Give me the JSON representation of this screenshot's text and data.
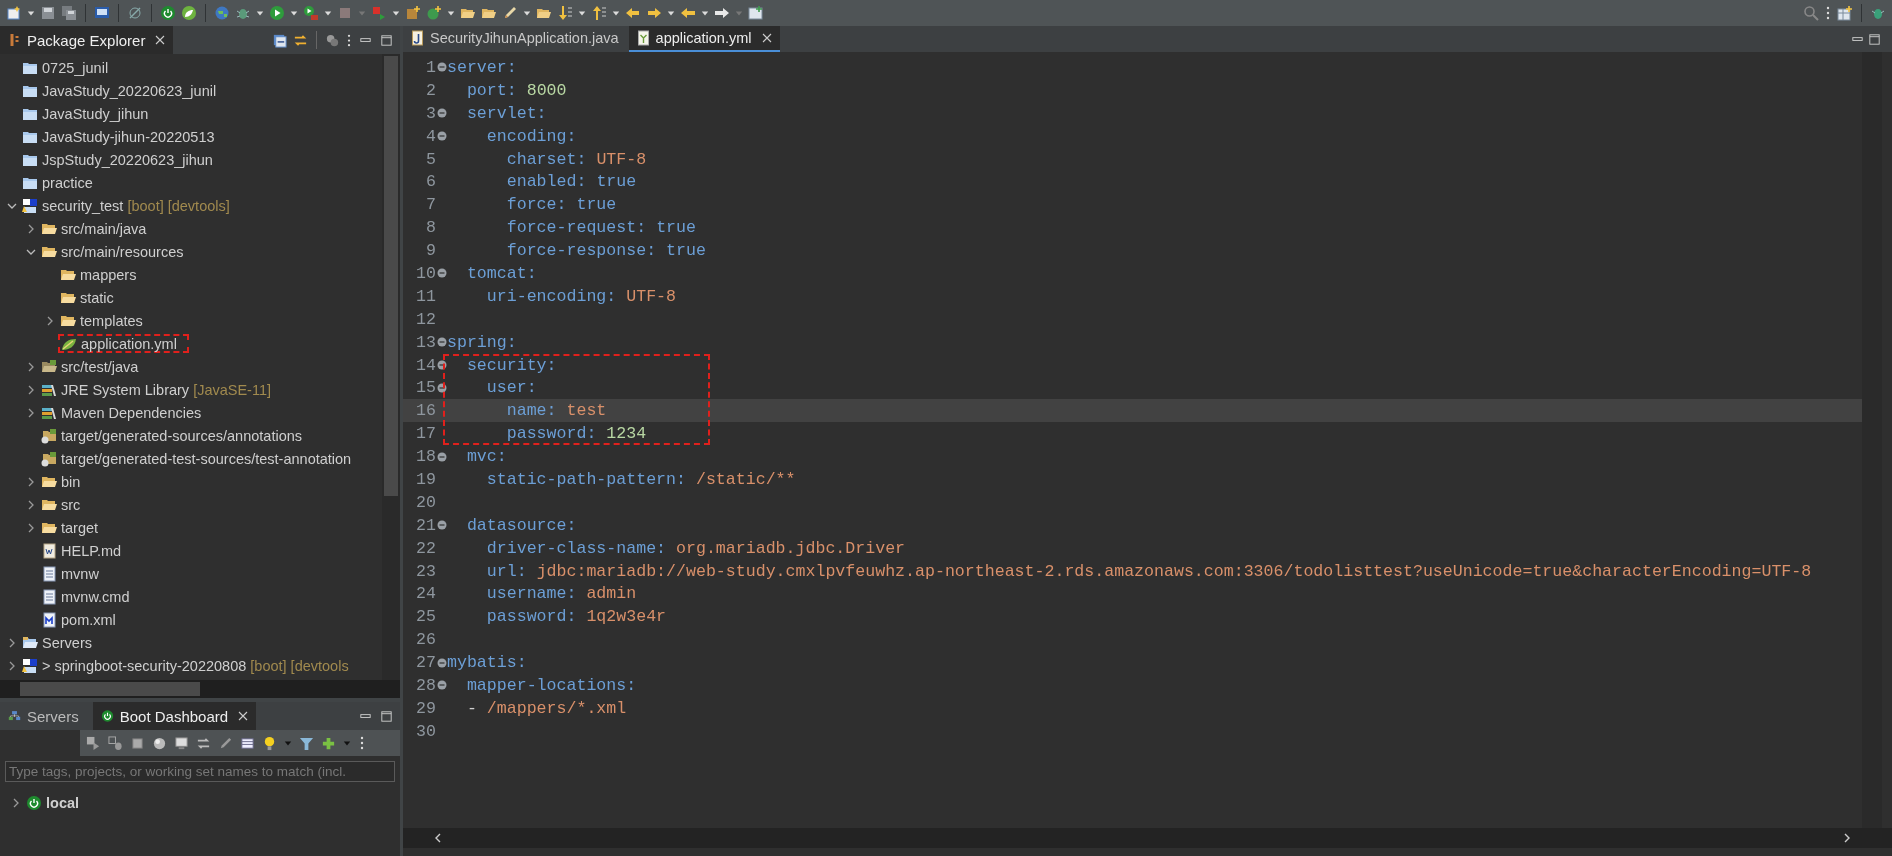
{
  "package_explorer": {
    "tabs": [
      {
        "label": "Package Explorer",
        "selected": true
      }
    ],
    "tree": [
      {
        "label": "0725_junil",
        "kind": "project"
      },
      {
        "label": "JavaStudy_20220623_junil",
        "kind": "project"
      },
      {
        "label": "JavaStudy_jihun",
        "kind": "project"
      },
      {
        "label": "JavaStudy-jihun-20220513",
        "kind": "project"
      },
      {
        "label": "JspStudy_20220623_jihun",
        "kind": "project"
      },
      {
        "label": "practice",
        "kind": "project"
      },
      {
        "label": "security_test",
        "decoration": "[boot] [devtools]",
        "kind": "boot",
        "expanded": true,
        "children": [
          {
            "label": "src/main/java",
            "kind": "folder",
            "expanded": false
          },
          {
            "label": "src/main/resources",
            "kind": "folder",
            "expanded": true,
            "children": [
              {
                "label": "mappers",
                "kind": "folder"
              },
              {
                "label": "static",
                "kind": "folder"
              },
              {
                "label": "templates",
                "kind": "folder",
                "expanded": false
              },
              {
                "label": "application.yml",
                "kind": "yaml",
                "highlighted": true
              }
            ]
          },
          {
            "label": "src/test/java",
            "kind": "test",
            "expanded": false
          },
          {
            "label": "JRE System Library",
            "decoration": "[JavaSE-11]",
            "kind": "library",
            "expanded": false
          },
          {
            "label": "Maven Dependencies",
            "kind": "library",
            "expanded": false
          },
          {
            "label": "target/generated-sources/annotations",
            "kind": "generated"
          },
          {
            "label": "target/generated-test-sources/test-annotation",
            "kind": "generated"
          },
          {
            "label": "bin",
            "kind": "folder",
            "expanded": false
          },
          {
            "label": "src",
            "kind": "folder",
            "expanded": false
          },
          {
            "label": "target",
            "kind": "folder",
            "expanded": false
          },
          {
            "label": "HELP.md",
            "kind": "markdown"
          },
          {
            "label": "mvnw",
            "kind": "text"
          },
          {
            "label": "mvnw.cmd",
            "kind": "text"
          },
          {
            "label": "pom.xml",
            "kind": "maven"
          }
        ]
      },
      {
        "label": "Servers",
        "kind": "servers",
        "expanded": false
      },
      {
        "label": "springboot-security-20220808",
        "prefix": ">",
        "decoration": "[boot] [devtools",
        "kind": "boot",
        "expanded": false
      }
    ]
  },
  "boot_dashboard": {
    "tabs": [
      {
        "label": "Servers",
        "kind": "servers",
        "selected": false
      },
      {
        "label": "Boot Dashboard",
        "kind": "power",
        "selected": true
      }
    ],
    "filter": {
      "placeholder": "Type tags, projects, or working set names to match (incl."
    },
    "tree": [
      {
        "label": "local",
        "expanded": false
      }
    ]
  },
  "editor": {
    "tabs": [
      {
        "label": "SecurityJihunApplication.java",
        "kind": "java",
        "selected": false
      },
      {
        "label": "application.yml",
        "kind": "yaml",
        "selected": true
      }
    ],
    "code_lines": [
      {
        "number": "1",
        "key": "server:",
        "foldable": true
      },
      {
        "number": "2",
        "key": "  port:",
        "value": "8000",
        "kind": "number"
      },
      {
        "number": "3",
        "key": "  servlet:",
        "foldable": true
      },
      {
        "number": "4",
        "key": "    encoding:",
        "foldable": true
      },
      {
        "number": "5",
        "key": "      charset:",
        "value": "UTF-8",
        "kind": "string"
      },
      {
        "number": "6",
        "key": "      enabled:",
        "value": "true",
        "kind": "boolean"
      },
      {
        "number": "7",
        "key": "      force:",
        "value": "true",
        "kind": "boolean"
      },
      {
        "number": "8",
        "key": "      force-request:",
        "value": "true",
        "kind": "boolean"
      },
      {
        "number": "9",
        "key": "      force-response:",
        "value": "true",
        "kind": "boolean"
      },
      {
        "number": "10",
        "key": "  tomcat:",
        "foldable": true
      },
      {
        "number": "11",
        "key": "    uri-encoding:",
        "value": "UTF-8",
        "kind": "string"
      },
      {
        "number": "12"
      },
      {
        "number": "13",
        "key": "spring:",
        "foldable": true
      },
      {
        "number": "14",
        "key": "  security:",
        "foldable": true,
        "highlighted": true
      },
      {
        "number": "15",
        "key": "    user:",
        "foldable": true,
        "highlighted": true
      },
      {
        "number": "16",
        "key": "      name:",
        "value": "test",
        "kind": "string",
        "highlighted": true,
        "current": true
      },
      {
        "number": "17",
        "key": "      password:",
        "value": "1234",
        "kind": "number",
        "highlighted": true
      },
      {
        "number": "18",
        "key": "  mvc:",
        "foldable": true
      },
      {
        "number": "19",
        "key": "    static-path-pattern:",
        "value": "/static/**",
        "kind": "string"
      },
      {
        "number": "20"
      },
      {
        "number": "21",
        "key": "  datasource:",
        "foldable": true
      },
      {
        "number": "22",
        "key": "    driver-class-name:",
        "value": "org.mariadb.jdbc.Driver",
        "kind": "string"
      },
      {
        "number": "23",
        "key": "    url:",
        "value": "jdbc:mariadb://web-study.cmxlpvfeuwhz.ap-northeast-2.rds.amazonaws.com:3306/todolisttest?useUnicode=true&characterEncoding=UTF-8",
        "kind": "string"
      },
      {
        "number": "24",
        "key": "    username:",
        "value": "admin",
        "kind": "string"
      },
      {
        "number": "25",
        "key": "    password:",
        "value": "1q2w3e4r",
        "kind": "string"
      },
      {
        "number": "26"
      },
      {
        "number": "27",
        "key": "mybatis:",
        "foldable": true
      },
      {
        "number": "28",
        "key": "  mapper-locations:",
        "foldable": true
      },
      {
        "number": "29",
        "key": "  -",
        "value": "/mappers/*.xml",
        "kind": "string"
      },
      {
        "number": "30"
      }
    ]
  }
}
